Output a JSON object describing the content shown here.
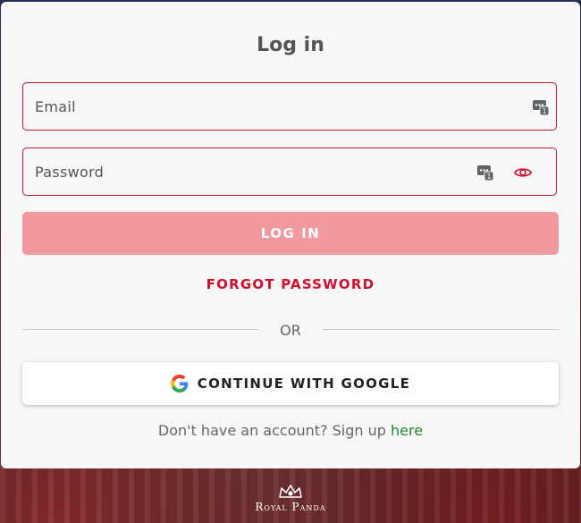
{
  "login": {
    "title": "Log in",
    "email_placeholder": "Email",
    "password_placeholder": "Password",
    "login_button": "LOG IN",
    "forgot_password": "FORGOT PASSWORD",
    "or_text": "OR",
    "google_button": "CONTINUE WITH GOOGLE",
    "signup_prompt": "Don't have an account? Sign up ",
    "signup_link": "here"
  },
  "brand": {
    "name": "Royal Panda"
  },
  "colors": {
    "accent": "#d20f2c",
    "login_button_bg": "#f2999f",
    "link_green": "#1e8a2e",
    "card_bg": "#f7f7f7"
  },
  "icons": [
    "key-manager-icon",
    "eye-icon",
    "google-g-icon",
    "crown-logo-icon"
  ]
}
